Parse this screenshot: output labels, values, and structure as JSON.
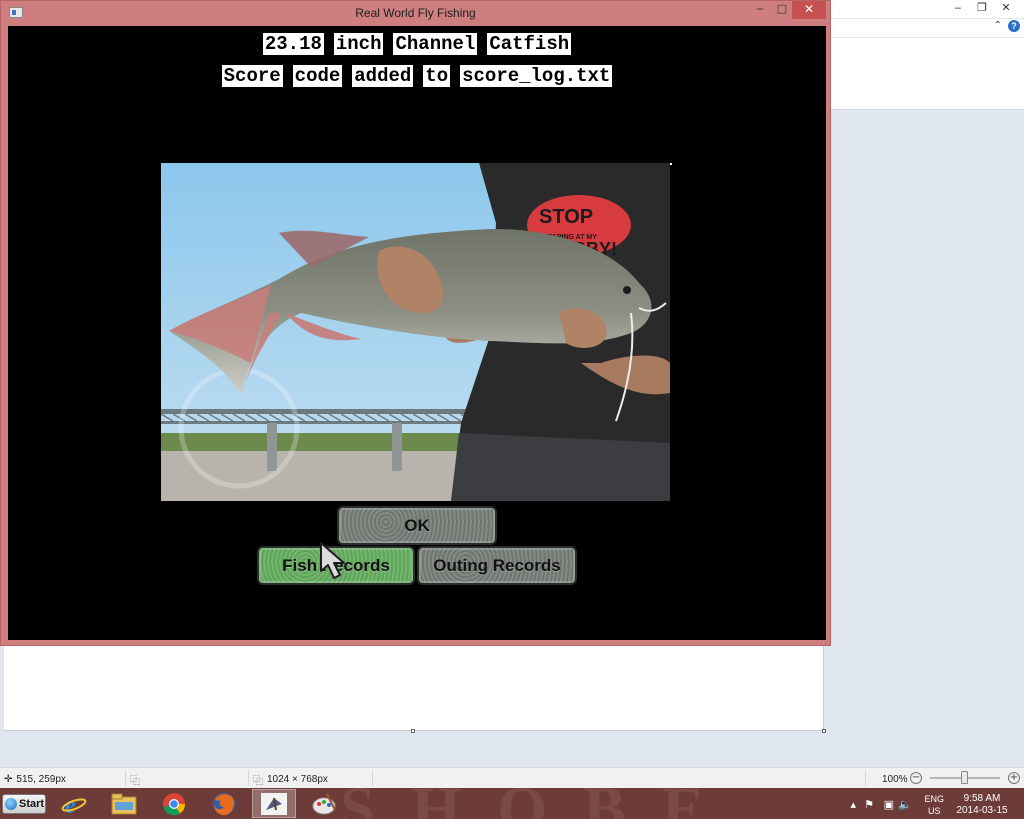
{
  "game": {
    "title": "Real World Fly Fishing",
    "headline_words": [
      "23.18",
      "inch",
      "Channel",
      "Catfish"
    ],
    "message_words": [
      "Score",
      "code",
      "added",
      "to",
      "score_log.txt"
    ],
    "buttons": {
      "ok": "OK",
      "fish_records": "Fish Records",
      "outing_records": "Outing Records"
    },
    "photo_shirt_text": [
      "STOP",
      "STARING AT MY",
      "BBY!"
    ]
  },
  "background_app": {
    "status": {
      "cursor_pos": "515, 259px",
      "image_size": "1024 × 768px",
      "zoom": "100%"
    }
  },
  "taskbar": {
    "start_label": "Start",
    "language": "ENG",
    "region": "US",
    "time": "9:58 AM",
    "date": "2014-03-15"
  },
  "colors": {
    "window_border": "#cf7e80",
    "close_button": "#c75050",
    "ok_button": "#757c75",
    "fish_records_button": "#65aa61",
    "taskbar": "#6e3c38"
  },
  "icons": [
    "app-icon",
    "ie-icon",
    "file-explorer-icon",
    "chrome-icon",
    "firefox-icon",
    "fly-fishing-icon",
    "paint-icon",
    "flag-icon",
    "network-icon",
    "volume-icon"
  ]
}
